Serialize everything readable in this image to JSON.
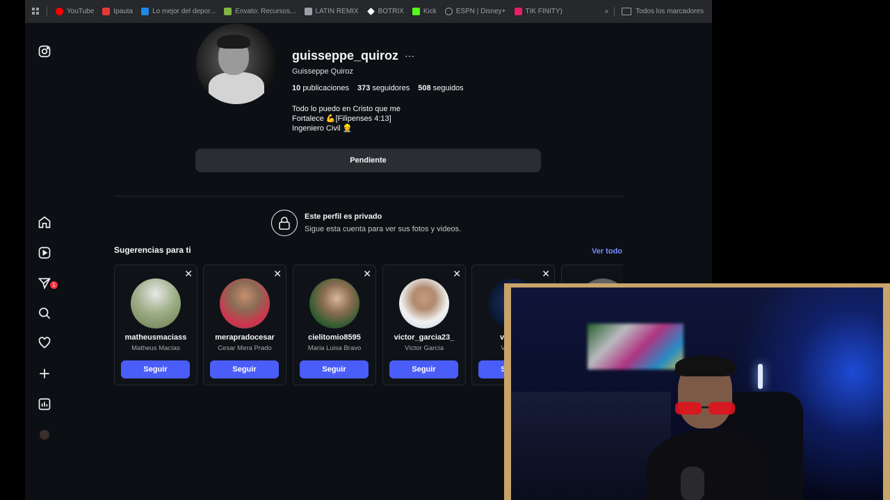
{
  "bookmarks": {
    "items": [
      {
        "label": "YouTube",
        "icon": "youtube-icon",
        "color": "#ff0000"
      },
      {
        "label": "Ipauta",
        "icon": "ipauta-icon",
        "color": "#e53935"
      },
      {
        "label": "Lo mejor del depor...",
        "icon": "sports-icon",
        "color": "#1e88e5"
      },
      {
        "label": "Envato: Recursos...",
        "icon": "envato-icon",
        "color": "#81b441"
      },
      {
        "label": "LATIN REMIX",
        "icon": "image-icon",
        "color": "#9aa0a6"
      },
      {
        "label": "BOTRIX",
        "icon": "botrix-icon",
        "color": "#ffffff"
      },
      {
        "label": "Kick",
        "icon": "kick-icon",
        "color": "#53fc18"
      },
      {
        "label": "ESPN | Disney+",
        "icon": "globe-icon",
        "color": "#9aa0a6"
      },
      {
        "label": "TIK FINITY)",
        "icon": "tikfinity-icon",
        "color": "#e91e63"
      }
    ],
    "more": "»",
    "all_label": "Todos los marcadores"
  },
  "profile": {
    "username": "guisseppe_quiroz",
    "options": "···",
    "full_name": "Guisseppe Quiroz",
    "posts_count": "10",
    "posts_label": "publicaciones",
    "followers_count": "373",
    "followers_label": "seguidores",
    "following_count": "508",
    "following_label": "seguidos",
    "bio_line1": "Todo lo puedo en Cristo que me",
    "bio_line2": "Fortalece 💪[Filipenses 4:13]",
    "bio_line3": "Ingeniero Civil 👷",
    "pending_label": "Pendiente"
  },
  "private": {
    "title": "Este perfil es privado",
    "subtitle": "Sigue esta cuenta para ver sus fotos y videos."
  },
  "suggestions": {
    "title": "Sugerencias para ti",
    "see_all": "Ver todo",
    "follow_label": "Seguir",
    "cards": [
      {
        "username": "matheusmaciass",
        "name": "Matheus Macías",
        "color": "#7a8a6a"
      },
      {
        "username": "merapradocesar",
        "name": "Cesar Mera Prado",
        "color": "#c0394f"
      },
      {
        "username": "cielitomio8595",
        "name": "Maria Luisa Bravo",
        "color": "#6b5a3a"
      },
      {
        "username": "victor_garcia23_",
        "name": "Víctor García",
        "color": "#9bb0c8"
      },
      {
        "username": "vegasp",
        "name": "Vegas P",
        "color": "#0d1b3a"
      }
    ]
  },
  "sidebar": {
    "notification_count": "1"
  }
}
